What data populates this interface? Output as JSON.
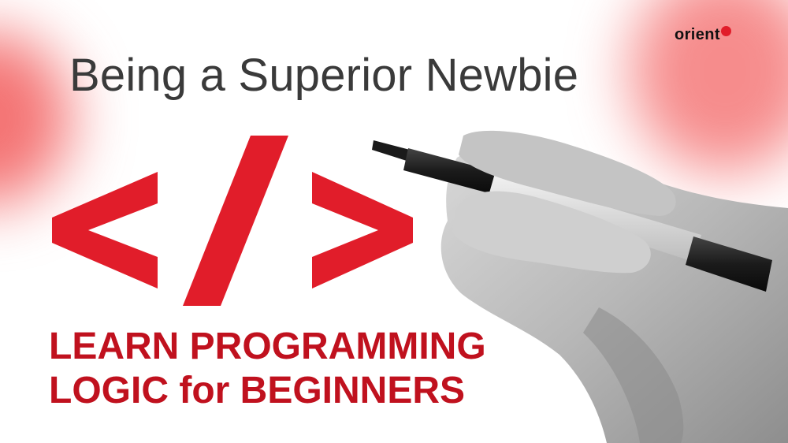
{
  "banner": {
    "subtitle": "Being a Superior Newbie",
    "logo_text": "orient",
    "code_symbol": "</>",
    "headline_line1": "LEARN PROGRAMMING",
    "headline_line2": "LOGIC for BEGINNERS"
  },
  "colors": {
    "accent": "#e11d2a",
    "headline": "#c0111e",
    "subtitle": "#3a3a3a",
    "glow": "#f04646"
  },
  "image": {
    "subject": "hand-holding-marker-photo"
  }
}
